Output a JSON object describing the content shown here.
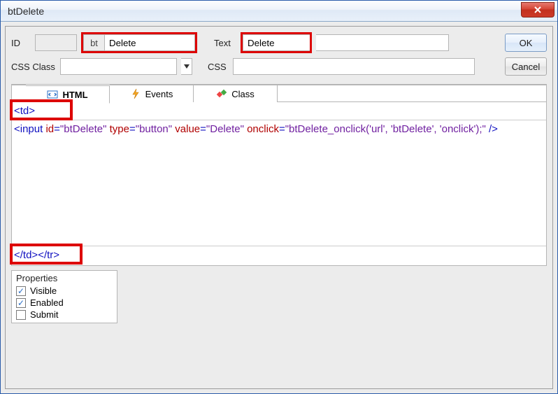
{
  "window": {
    "title": "btDelete"
  },
  "buttons": {
    "ok": "OK",
    "cancel": "Cancel"
  },
  "form": {
    "id_label": "ID",
    "id_prefix": "bt",
    "id_value": "Delete",
    "text_label": "Text",
    "text_value": "Delete",
    "cssclass_label": "CSS Class",
    "cssclass_value": "",
    "css_label": "CSS",
    "css_value": ""
  },
  "tabs": {
    "html": "HTML",
    "events": "Events",
    "class": "Class"
  },
  "code": {
    "open_td": "<td>",
    "line_text": "<input id=\"btDelete\" type=\"button\" value=\"Delete\" onclick=\"btDelete_onclick('url', 'btDelete', 'onclick');\" />",
    "close_td": "</td></tr>"
  },
  "properties": {
    "title": "Properties",
    "items": [
      {
        "label": "Visible",
        "checked": true
      },
      {
        "label": "Enabled",
        "checked": true
      },
      {
        "label": "Submit",
        "checked": false
      }
    ]
  }
}
